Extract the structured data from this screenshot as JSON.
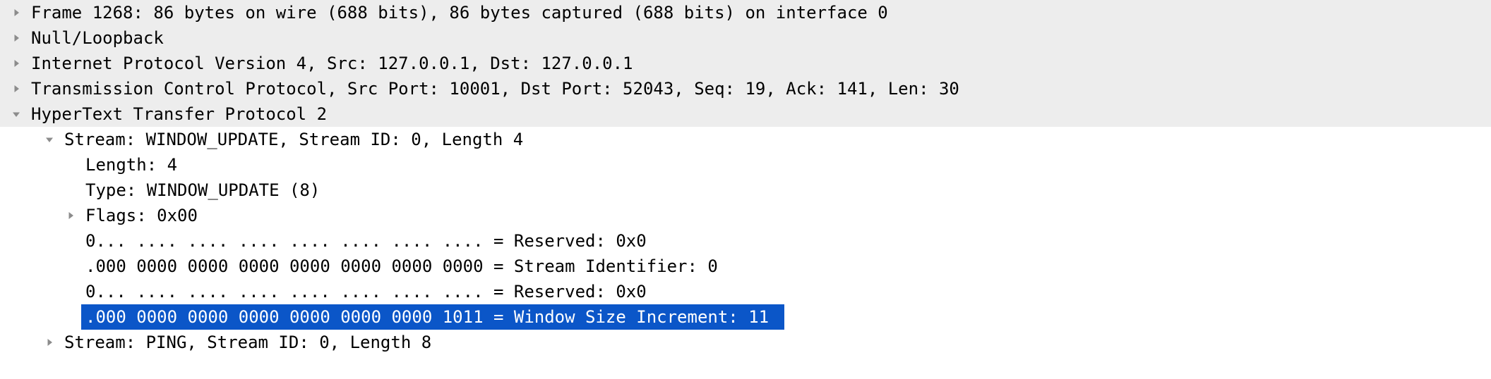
{
  "pane": {
    "name": "packet-details",
    "colors": {
      "selection_background": "#0b56c8",
      "selection_text": "#ffffff",
      "protocol_row_background": "#ededed",
      "default_background": "#ffffff",
      "text": "#000000",
      "twisty": "#8c8c8c"
    }
  },
  "rows": [
    {
      "id": "frame",
      "text": "Frame 1268: 86 bytes on wire (688 bits), 86 bytes captured (688 bits) on interface 0",
      "indent": 0,
      "twisty": "collapsed-triangle-icon",
      "expanded": false,
      "selected": false,
      "band": "protocol"
    },
    {
      "id": "null-loopback",
      "text": "Null/Loopback",
      "indent": 0,
      "twisty": "collapsed-triangle-icon",
      "expanded": false,
      "selected": false,
      "band": "protocol"
    },
    {
      "id": "ipv4",
      "text": "Internet Protocol Version 4, Src: 127.0.0.1, Dst: 127.0.0.1",
      "indent": 0,
      "twisty": "collapsed-triangle-icon",
      "expanded": false,
      "selected": false,
      "band": "protocol"
    },
    {
      "id": "tcp",
      "text": "Transmission Control Protocol, Src Port: 10001, Dst Port: 52043, Seq: 19, Ack: 141, Len: 30",
      "indent": 0,
      "twisty": "collapsed-triangle-icon",
      "expanded": false,
      "selected": false,
      "band": "protocol"
    },
    {
      "id": "http2",
      "text": "HyperText Transfer Protocol 2",
      "indent": 0,
      "twisty": "expanded-triangle-icon",
      "expanded": true,
      "selected": false,
      "band": "protocol"
    },
    {
      "id": "stream-window-update",
      "text": "Stream: WINDOW_UPDATE, Stream ID: 0, Length 4",
      "indent": 1,
      "twisty": "expanded-triangle-icon",
      "expanded": true,
      "selected": false,
      "band": "plain"
    },
    {
      "id": "length",
      "text": "Length: 4",
      "indent": 2,
      "twisty": "none",
      "expanded": false,
      "selected": false,
      "band": "plain"
    },
    {
      "id": "type",
      "text": "Type: WINDOW_UPDATE (8)",
      "indent": 2,
      "twisty": "none",
      "expanded": false,
      "selected": false,
      "band": "plain"
    },
    {
      "id": "flags",
      "text": "Flags: 0x00",
      "indent": 2,
      "twisty": "collapsed-triangle-icon",
      "expanded": false,
      "selected": false,
      "band": "plain"
    },
    {
      "id": "reserved-1",
      "text": "0... .... .... .... .... .... .... .... = Reserved: 0x0",
      "indent": 2,
      "twisty": "none",
      "expanded": false,
      "selected": false,
      "band": "plain"
    },
    {
      "id": "stream-identifier",
      "text": ".000 0000 0000 0000 0000 0000 0000 0000 = Stream Identifier: 0",
      "indent": 2,
      "twisty": "none",
      "expanded": false,
      "selected": false,
      "band": "plain"
    },
    {
      "id": "reserved-2",
      "text": "0... .... .... .... .... .... .... .... = Reserved: 0x0",
      "indent": 2,
      "twisty": "none",
      "expanded": false,
      "selected": false,
      "band": "plain"
    },
    {
      "id": "window-size-increment",
      "text": ".000 0000 0000 0000 0000 0000 0000 1011 = Window Size Increment: 11",
      "indent": 2,
      "twisty": "none",
      "expanded": false,
      "selected": true,
      "band": "plain"
    },
    {
      "id": "stream-ping",
      "text": "Stream: PING, Stream ID: 0, Length 8",
      "indent": 1,
      "twisty": "collapsed-triangle-icon",
      "expanded": false,
      "selected": false,
      "band": "plain"
    }
  ]
}
